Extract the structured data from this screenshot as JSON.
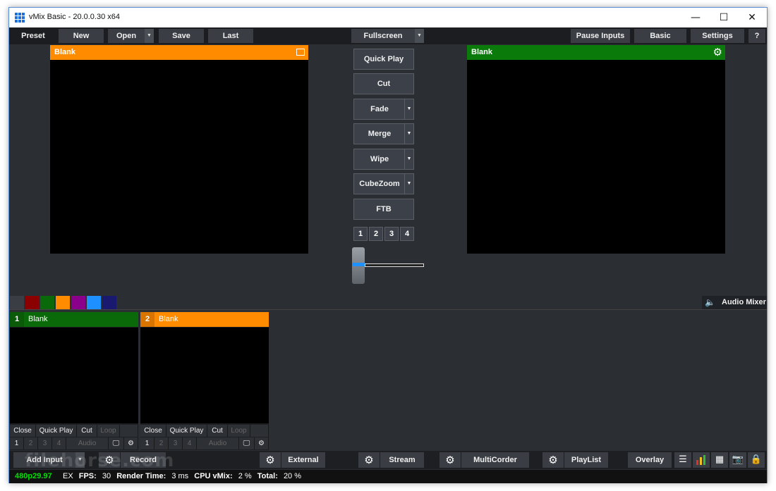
{
  "window": {
    "title": "vMix Basic - 20.0.0.30 x64",
    "minimize": "—",
    "maximize": "☐",
    "close": "✕"
  },
  "topbar": {
    "preset": "Preset",
    "new": "New",
    "open": "Open",
    "save": "Save",
    "last": "Last",
    "fullscreen": "Fullscreen",
    "pause_inputs": "Pause Inputs",
    "basic": "Basic",
    "settings": "Settings",
    "help": "?"
  },
  "preview": {
    "title": "Blank",
    "color": "#ff8c00"
  },
  "output": {
    "title": "Blank",
    "color": "#0a7a0a"
  },
  "transitions": {
    "quick_play": "Quick Play",
    "cut": "Cut",
    "fade": "Fade",
    "merge": "Merge",
    "wipe": "Wipe",
    "cubezoom": "CubeZoom",
    "ftb": "FTB",
    "numbers": [
      "1",
      "2",
      "3",
      "4"
    ],
    "tbar_position": 0
  },
  "color_swatches": [
    "#3a3e44",
    "#8b0000",
    "#0a6a0a",
    "#ff8c00",
    "#8b008b",
    "#1e90ff",
    "#191970"
  ],
  "audio_mixer": {
    "label": "Audio Mixer",
    "icon": "speaker-icon"
  },
  "inputs": [
    {
      "number": "1",
      "name": "Blank",
      "color": "#0a6a0a",
      "buttons": [
        "Close",
        "Quick Play",
        "Cut",
        "Loop"
      ],
      "overlays": [
        "1",
        "2",
        "3",
        "4",
        "Audio"
      ]
    },
    {
      "number": "2",
      "name": "Blank",
      "color": "#ff8c00",
      "buttons": [
        "Close",
        "Quick Play",
        "Cut",
        "Loop"
      ],
      "overlays": [
        "1",
        "2",
        "3",
        "4",
        "Audio"
      ]
    }
  ],
  "bottombar": {
    "add_input": "Add Input",
    "record": "Record",
    "external": "External",
    "stream": "Stream",
    "multicorder": "MultiCorder",
    "playlist": "PlayList",
    "overlay": "Overlay"
  },
  "status": {
    "format": "480p29.97",
    "ex": "EX",
    "fps_label": "FPS:",
    "fps": "30",
    "render_label": "Render Time:",
    "render": "3 ms",
    "cpu_label": "CPU vMix:",
    "cpu": "2 %",
    "total_label": "Total:",
    "total": "20 %"
  },
  "watermark": "filehorse.com"
}
